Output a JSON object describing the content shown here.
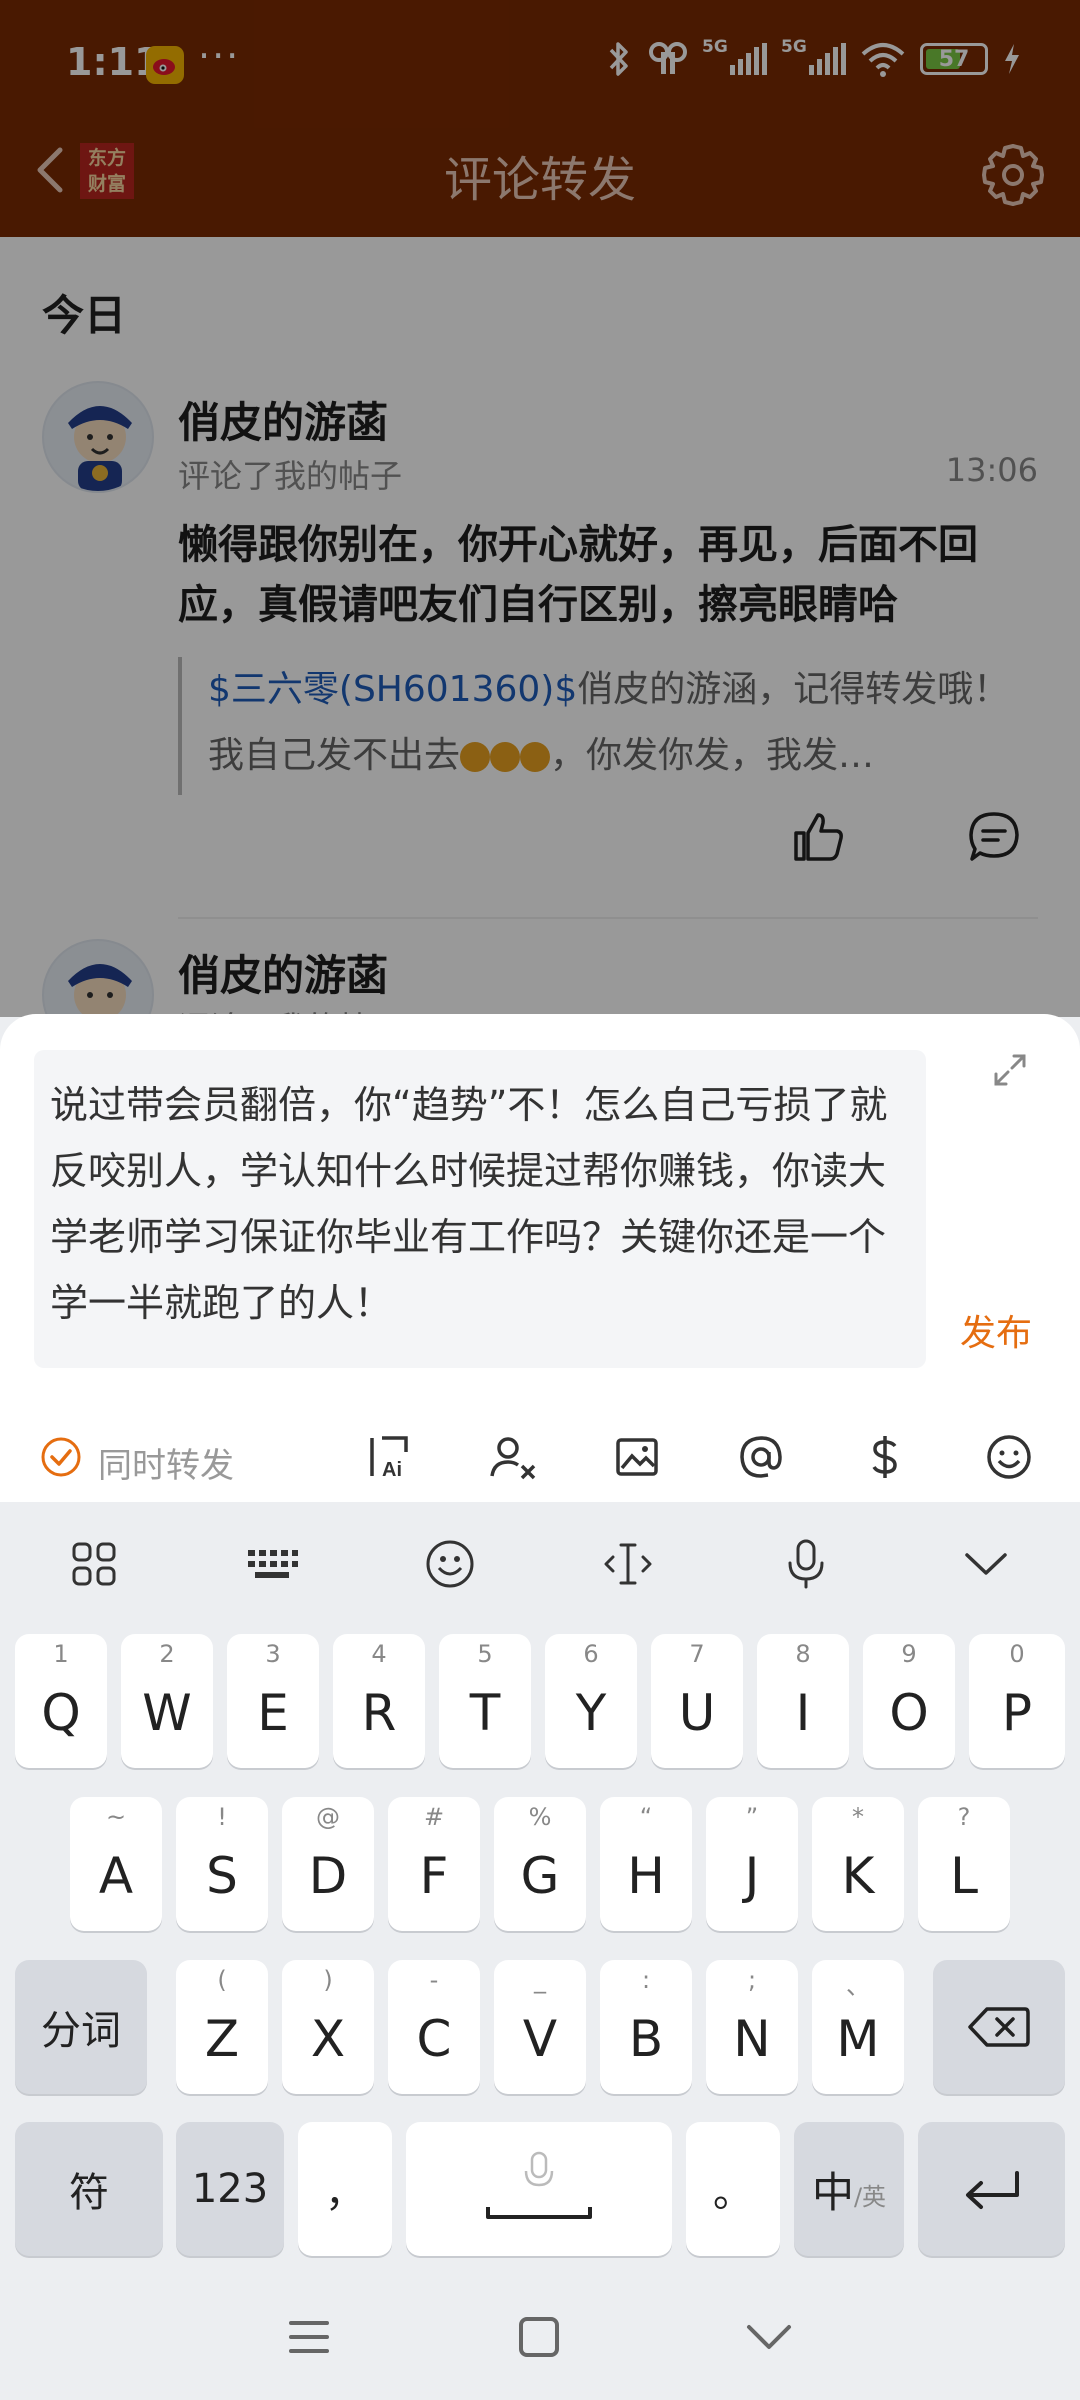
{
  "status_bar": {
    "time": "1:11",
    "more": "···",
    "net1": "5G",
    "net2": "5G",
    "battery": "57"
  },
  "header": {
    "title": "评论转发",
    "logo": "东方财富"
  },
  "feed": {
    "section": "今日",
    "items": [
      {
        "user": "俏皮的游菡",
        "action": "评论了我的帖子",
        "time": "13:06",
        "text": "懒得跟你别在，你开心就好，再见，后面不回应，真假请吧友们自行区别，擦亮眼睛哈",
        "quote_stock": "$三六零(SH601360)$",
        "quote_text": "俏皮的游涵，记得转发哦！我自己发不出去",
        "quote_tail": "，你发你发，我发…"
      },
      {
        "user": "俏皮的游菡",
        "action": "评论了我的帖子"
      }
    ]
  },
  "composer": {
    "text": "说过带会员翻倍，你“趋势”不！怎么自己亏损了就反咬别人，学认知什么时候提过帮你赚钱，你读大学老师学习保证你毕业有工作吗？关键你还是一个学一半就跑了的人！",
    "publish": "发布",
    "repost_label": "同时转发"
  },
  "keyboard": {
    "row1": [
      {
        "k": "Q",
        "h": "1"
      },
      {
        "k": "W",
        "h": "2"
      },
      {
        "k": "E",
        "h": "3"
      },
      {
        "k": "R",
        "h": "4"
      },
      {
        "k": "T",
        "h": "5"
      },
      {
        "k": "Y",
        "h": "6"
      },
      {
        "k": "U",
        "h": "7"
      },
      {
        "k": "I",
        "h": "8"
      },
      {
        "k": "O",
        "h": "9"
      },
      {
        "k": "P",
        "h": "0"
      }
    ],
    "row2": [
      {
        "k": "A",
        "h": "~"
      },
      {
        "k": "S",
        "h": "!"
      },
      {
        "k": "D",
        "h": "@"
      },
      {
        "k": "F",
        "h": "#"
      },
      {
        "k": "G",
        "h": "%"
      },
      {
        "k": "H",
        "h": "“"
      },
      {
        "k": "J",
        "h": "”"
      },
      {
        "k": "K",
        "h": "*"
      },
      {
        "k": "L",
        "h": "?"
      }
    ],
    "row3": [
      {
        "k": "Z",
        "h": "("
      },
      {
        "k": "X",
        "h": ")"
      },
      {
        "k": "C",
        "h": "-"
      },
      {
        "k": "V",
        "h": "_"
      },
      {
        "k": "B",
        "h": ":"
      },
      {
        "k": "N",
        "h": ";"
      },
      {
        "k": "M",
        "h": "、"
      }
    ],
    "segment": "分词",
    "symbols": "符",
    "numbers": "123",
    "comma": "，",
    "period": "。",
    "lang_main": "中",
    "lang_sub": "/英"
  },
  "colors": {
    "header_bg": "#7b2a02",
    "accent": "#e56d10",
    "link": "#1f5db9"
  }
}
